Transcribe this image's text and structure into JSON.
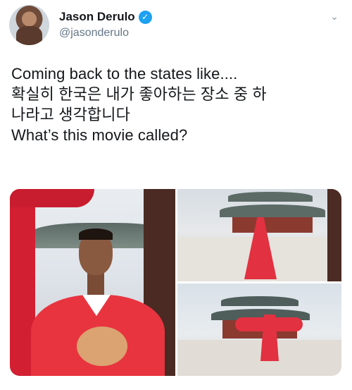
{
  "user": {
    "display_name": "Jason Derulo",
    "handle": "@jasonderulo",
    "verified": true
  },
  "icons": {
    "verified": "verified-badge-icon",
    "menu": "chevron-down-icon"
  },
  "tweet": {
    "lines": [
      "Coming back to the states like....",
      "확실히 한국은 내가 좋아하는 장소 중 하",
      "나라고 생각합니다",
      "What’s this movie called?"
    ]
  },
  "colors": {
    "accent": "#1da1f2",
    "text": "#14171a",
    "muted": "#657786",
    "robe_red": "#e23140"
  }
}
